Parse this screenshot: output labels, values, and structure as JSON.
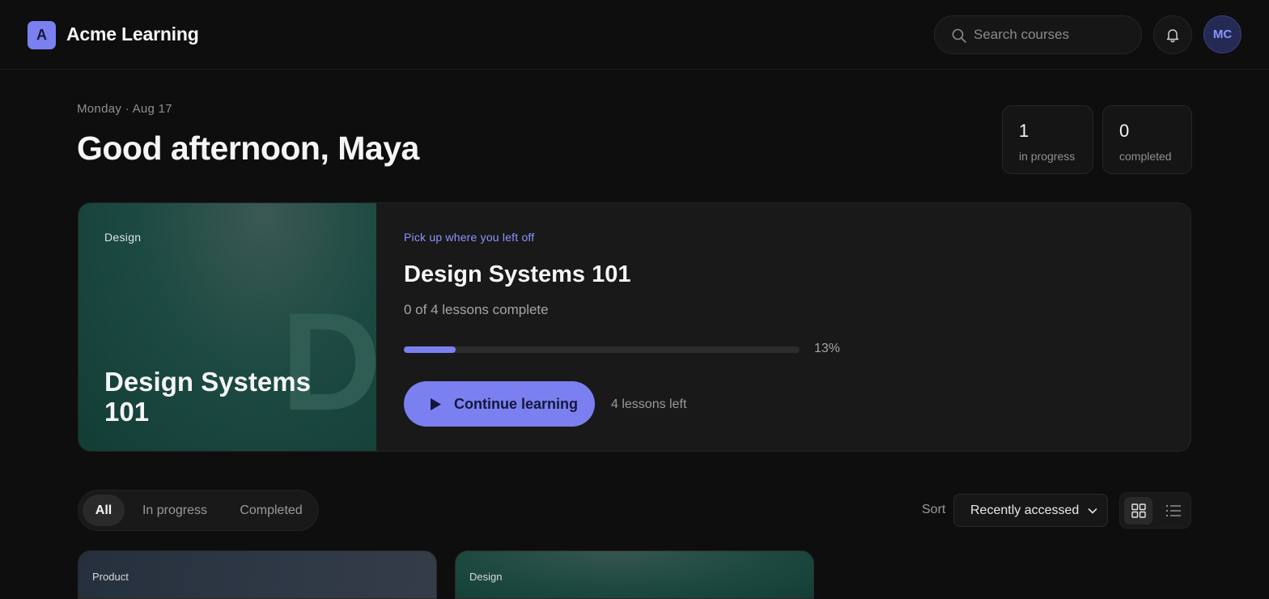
{
  "app": {
    "logo_letter": "A",
    "name": "Acme Learning"
  },
  "search": {
    "placeholder": "Search courses",
    "value": ""
  },
  "user": {
    "initials": "MC"
  },
  "greeting": {
    "date": "Monday · Aug 17",
    "headline": "Good afternoon, Maya"
  },
  "stats": [
    {
      "value": "1",
      "label": "in progress"
    },
    {
      "value": "0",
      "label": "completed"
    }
  ],
  "featured": {
    "category": "Design",
    "cover_letter": "D",
    "cover_title": "Design Systems 101",
    "eyebrow": "Pick up where you left off",
    "title": "Design Systems 101",
    "subtitle": "0 of 4 lessons complete",
    "progress_percent": 13,
    "progress_label": "13%",
    "cta_label": "Continue learning",
    "lessons_left": "4 lessons left"
  },
  "filters": {
    "tabs": [
      {
        "label": "All",
        "active": true
      },
      {
        "label": "In progress",
        "active": false
      },
      {
        "label": "Completed",
        "active": false
      }
    ]
  },
  "sort": {
    "label": "Sort",
    "selected": "Recently accessed"
  },
  "view": {
    "selected": "grid",
    "options": [
      "grid",
      "list"
    ]
  },
  "courses": [
    {
      "category": "Product"
    },
    {
      "category": "Design"
    }
  ],
  "colors": {
    "accent": "#7b80f0",
    "background": "#0e0e0e",
    "card": "#191919",
    "cover_green": "#1d4a42"
  },
  "icons": [
    "search-icon",
    "bell-icon",
    "play-icon",
    "chevron-down-icon",
    "grid-view-icon",
    "list-view-icon"
  ]
}
